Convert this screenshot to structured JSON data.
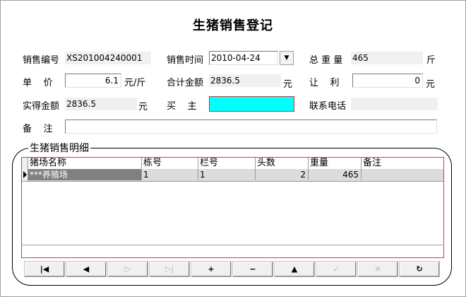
{
  "window": {
    "title": "生猪销售登记"
  },
  "form": {
    "sale_no_label": "销售编号",
    "sale_no": "XS201004240001",
    "sale_time_label": "销售时间",
    "sale_time": "2010-04-24",
    "total_weight_label": "总 重 量",
    "total_weight": "465",
    "total_weight_unit": "斤",
    "unit_price_label": "单    价",
    "unit_price": "6.1",
    "unit_price_unit": "元/斤",
    "total_amount_label": "合计金额",
    "total_amount": "2836.5",
    "total_amount_unit": "元",
    "discount_label": "让    利",
    "discount": "0",
    "discount_unit": "元",
    "received_label": "实得金额",
    "received": "2836.5",
    "received_unit": "元",
    "buyer_label": "买    主",
    "buyer": "",
    "phone_label": "联系电话",
    "phone": "",
    "remark_label": "备    注",
    "remark": ""
  },
  "detail": {
    "title": "生猪销售明细",
    "columns": [
      "猪场名称",
      "栋号",
      "栏号",
      "头数",
      "重量",
      "备注"
    ],
    "rows": [
      {
        "farm": "***养殖场",
        "building": "1",
        "pen": "1",
        "heads": "2",
        "weight": "465",
        "remark": ""
      }
    ]
  },
  "navigator": {
    "buttons": [
      {
        "icon": "first-record-icon",
        "glyph": "|◀",
        "enabled": true
      },
      {
        "icon": "prior-record-icon",
        "glyph": "◀",
        "enabled": true
      },
      {
        "icon": "next-record-icon",
        "glyph": "▷",
        "enabled": false
      },
      {
        "icon": "last-record-icon",
        "glyph": "▷|",
        "enabled": false
      },
      {
        "icon": "insert-record-icon",
        "glyph": "+",
        "enabled": true
      },
      {
        "icon": "delete-record-icon",
        "glyph": "−",
        "enabled": true
      },
      {
        "icon": "edit-record-icon",
        "glyph": "▲",
        "enabled": true
      },
      {
        "icon": "post-record-icon",
        "glyph": "✓",
        "enabled": false
      },
      {
        "icon": "cancel-edit-icon",
        "glyph": "✕",
        "enabled": false
      },
      {
        "icon": "refresh-icon",
        "glyph": "↻",
        "enabled": true
      }
    ]
  },
  "colors": {
    "buyer_bg": "#00ffff",
    "grid_border": "#d04040",
    "selected_cell": "#808080"
  }
}
